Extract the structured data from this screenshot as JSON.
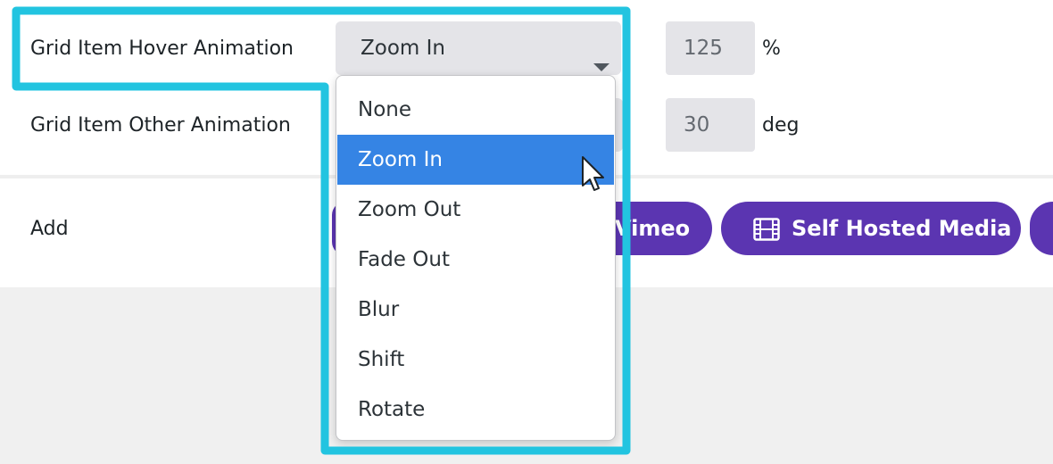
{
  "rows": [
    {
      "label": "Grid Item Hover Animation",
      "select_value": "Zoom In",
      "number_value": "125",
      "unit": "%"
    },
    {
      "label": "Grid Item Other Animation",
      "number_value": "30",
      "unit": "deg"
    }
  ],
  "add_row": {
    "label": "Add",
    "buttons": [
      {
        "label": "Vimeo",
        "visible_text": "Vimeo"
      },
      {
        "label": "Self Hosted Media",
        "icon": "film-icon"
      }
    ]
  },
  "dropdown": {
    "options": [
      "None",
      "Zoom In",
      "Zoom Out",
      "Fade Out",
      "Blur",
      "Shift",
      "Rotate"
    ],
    "selected": "Zoom In"
  },
  "colors": {
    "accent_purple": "#5b35b1",
    "selection_blue": "#3584e4",
    "highlight_cyan": "#22c4e0"
  }
}
